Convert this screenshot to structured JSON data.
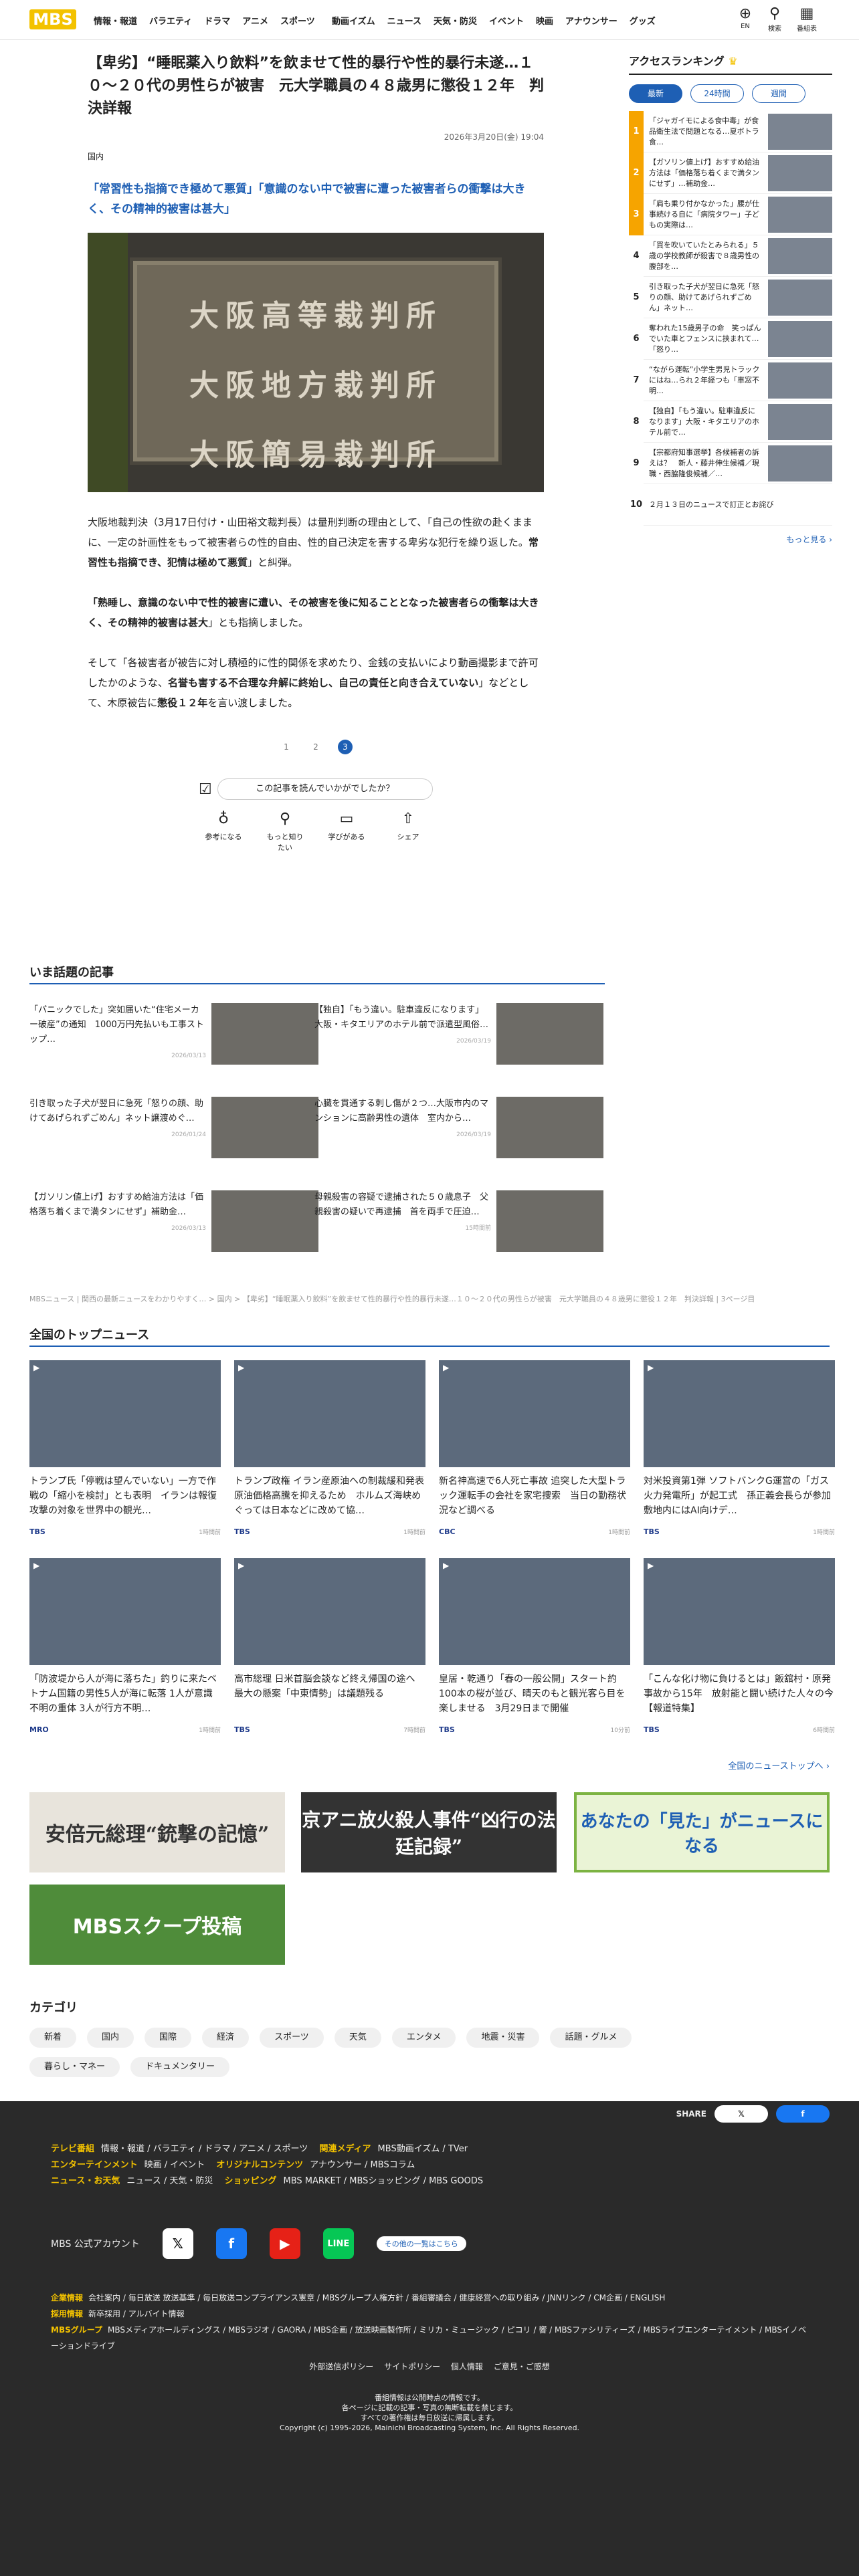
{
  "header": {
    "logo": "MBS",
    "nav1": [
      "情報・報道",
      "バラエティ",
      "ドラマ",
      "アニメ",
      "スポーツ"
    ],
    "nav2": [
      "動画イズム",
      "ニュース",
      "天気・防災",
      "イベント",
      "映画",
      "アナウンサー",
      "グッズ"
    ],
    "icons": [
      {
        "label": "EN",
        "icon": "globe-icon"
      },
      {
        "label": "検索",
        "icon": "search-icon"
      },
      {
        "label": "番組表",
        "icon": "calendar-icon"
      }
    ]
  },
  "article": {
    "title": "【卑劣】“睡眠薬入り飲料”を飲ませて性的暴行や性的暴行未遂…１０～２０代の男性らが被害　元大学職員の４８歳男に懲役１２年　判決詳報",
    "date": "2026年3月20日(金) 19:04",
    "category": "国内",
    "lead": "「常習性も指摘でき極めて悪質」「意識のない中で被害に遭った被害者らの衝撃は大きく、その精神的被害は甚大」",
    "plaque": [
      "大阪高等裁判所",
      "大阪地方裁判所",
      "大阪簡易裁判所"
    ],
    "p1a": "大阪地裁判決（3月17日付け・山田裕文裁判長）は量刑判断の理由として、「自己の性欲の赴くままに、一定の計画性をもって被害者らの性的自由、性的自己決定を害する卑劣な犯行を繰り返した。",
    "p1b": "常習性も指摘でき、犯情は極めて悪質",
    "p1c": "」と糾弾。",
    "p2a": "「熟睡し、意識のない中で性的被害に遭い、その被害を後に知ることとなった被害者らの衝撃は大きく、その精神的被害は甚大",
    "p2b": "」とも指摘しました。",
    "p3a": "そして「各被害者が被告に対し積極的に性的関係を求めたり、金銭の支払いにより動画撮影まで許可したかのような、",
    "p3b": "名誉も害する不合理な弁解に終始し、自己の責任と向き合えていない",
    "p3c": "」などとして、木原被告に",
    "p3d": "懲役１２年",
    "p3e": "を言い渡しました。",
    "pages": [
      "1",
      "2",
      "3"
    ],
    "survey": "この記事を読んでいかがでしたか？",
    "reactions": [
      {
        "label": "参考になる",
        "icon": "bulb-icon"
      },
      {
        "label": "もっと知りたい",
        "icon": "search-icon"
      },
      {
        "label": "学びがある",
        "icon": "book-icon"
      },
      {
        "label": "シェア",
        "icon": "share-icon"
      }
    ]
  },
  "ranking": {
    "title": "アクセスランキング",
    "tabs": [
      "最新",
      "24時間",
      "週間"
    ],
    "items": [
      {
        "no": "1",
        "text": "「ジャガイモによる食中毒」が食品衛生法で問題となる…夏ボトラ食…",
        "color": "#f6a400"
      },
      {
        "no": "2",
        "text": "【ガソリン値上げ】おすすめ給油方法は「価格落ち着くまで満タンにせず」…補助金…",
        "color": "#f6a400"
      },
      {
        "no": "3",
        "text": "「肩も乗り付かなかった」腰が仕事続ける自に「病院タワー」子どもの実際は…",
        "color": "#f6a400"
      },
      {
        "no": "4",
        "text": "「買を吹いていたとみられる」５歳の学校教師が殺害で８歳男性の腹部を…",
        "color": "#fff"
      },
      {
        "no": "5",
        "text": "引き取った子犬が翌日に急死「怒りの顔、助けてあげられずごめん」ネット…",
        "color": "#fff"
      },
      {
        "no": "6",
        "text": "奪われた15歳男子の命　笑っぱんでいた車とフェンスに挟まれて…「怒り…",
        "color": "#fff"
      },
      {
        "no": "7",
        "text": "“ながら運転”小学生男児トラックにはね…られ２年経つも「車窓不明…",
        "color": "#fff"
      },
      {
        "no": "8",
        "text": "【独自】「もう違い。駐車違反になります」大阪・キタエリアのホテル前で…",
        "color": "#fff"
      },
      {
        "no": "9",
        "text": "【宗都府知事選挙】各候補者の訴えは？　新人・藤井伸生候補／現職・西脇隆俊候補／…",
        "color": "#fff"
      },
      {
        "no": "10",
        "text": "２月１３日のニュースで訂正とお詫び",
        "color": "#fff"
      }
    ],
    "more": "もっと見る ›"
  },
  "topics": {
    "title": "いま話題の記事",
    "items": [
      {
        "t": "「パニックでした」突如届いた“住宅メーカー破産”の通知　1000万円先払いも工事ストップ…",
        "d": "2026/03/13"
      },
      {
        "t": "【独自】「もう違い。駐車違反になります」大阪・キタエリアのホテル前で派遣型風俗…",
        "d": "2026/03/19"
      },
      {
        "t": "引き取った子犬が翌日に急死「怒りの顔、助けてあげられずごめん」ネット譲渡めぐ…",
        "d": "2026/01/24"
      },
      {
        "t": "心臓を貫通する刺し傷が２つ…大阪市内のマンションに高齢男性の遺体　室内から…",
        "d": "2026/03/19"
      },
      {
        "t": "【ガソリン値上げ】おすすめ給油方法は「価格落ち着くまで満タンにせず」補助金…",
        "d": "2026/03/13"
      },
      {
        "t": "母親殺害の容疑で逮捕された５０歳息子　父親殺害の疑いで再逮捕　首を両手で圧迫…",
        "d": "15時間前"
      }
    ]
  },
  "breadcrumb": "MBSニュース | 関西の最新ニュースをわかりやすく… > 国内 > 【卑劣】“睡眠薬入り飲料”を飲ませて性的暴行や性的暴行未遂…１０～２０代の男性らが被害　元大学職員の４８歳男に懲役１２年　判決詳報 | 3ページ目",
  "national": {
    "title": "全国のトップニュース",
    "items": [
      {
        "t": "トランプ氏「停戦は望んでいない」一方で作戦の「縮小を検討」とも表明　イランは報復攻撃の対象を世界中の観光…",
        "s": "TBS",
        "d": "1時間前"
      },
      {
        "t": "トランプ政権 イラン産原油への制裁緩和発表 原油価格高騰を抑えるため　ホルムズ海峡めぐっては日本などに改めて協…",
        "s": "TBS",
        "d": "1時間前"
      },
      {
        "t": "新名神高速で6人死亡事故 追突した大型トラック運転手の会社を家宅捜索　当日の勤務状況など調べる",
        "s": "CBC",
        "d": "1時間前"
      },
      {
        "t": "対米投資第1弾 ソフトバンクG運営の「ガス火力発電所」が起工式　孫正義会長らが参加　敷地内にはAI向けデ…",
        "s": "TBS",
        "d": "1時間前"
      },
      {
        "t": "「防波堤から人が海に落ちた」釣りに来たベトナム国籍の男性5人が海に転落 1人が意識不明の重体 3人が行方不明…",
        "s": "MRO",
        "d": "1時間前"
      },
      {
        "t": "高市総理 日米首脳会談など終え帰国の途へ　最大の懸案「中東情勢」は議題残る",
        "s": "TBS",
        "d": "7時間前"
      },
      {
        "t": "皇居・乾通り「春の一般公開」スタート約100本の桜が並び、晴天のもと観光客ら目を楽しませる　3月29日まで開催",
        "s": "TBS",
        "d": "10分前"
      },
      {
        "t": "「こんな化け物に負けるとは」飯舘村・原発事故から15年　放射能と闘い続けた人々の今【報道特集】",
        "s": "TBS",
        "d": "6時間前"
      }
    ],
    "more": "全国のニューストップへ ›"
  },
  "banners": [
    "安倍元総理“銃撃の記憶”",
    "京アニ放火殺人事件“凶行の法廷記録”",
    "あなたの「見た」がニュースになる",
    "MBSスクープ投稿"
  ],
  "categories": {
    "title": "カテゴリ",
    "items": [
      "新着",
      "国内",
      "国際",
      "経済",
      "スポーツ",
      "天気",
      "エンタメ",
      "地震・災害",
      "話題・グルメ",
      "暮らし・マネー",
      "ドキュメンタリー"
    ]
  },
  "footer": {
    "share": "SHARE",
    "l1": [
      "テレビ番組",
      "情報・報道 / バラエティ / ドラマ / アニメ / スポーツ",
      "関連メディア",
      "MBS動画イズム / TVer"
    ],
    "l2": [
      "エンターテインメント",
      "映画 / イベント",
      "オリジナルコンテンツ",
      "アナウンサー / MBSコラム"
    ],
    "l3": [
      "ニュース・お天気",
      "ニュース / 天気・防災",
      "ショッピング",
      "MBS MARKET / MBSショッピング / MBS GOODS"
    ],
    "account": "MBS 公式アカウント",
    "list": "その他の一覧はこちら",
    "corp": [
      "企業情報",
      "会社案内 / 毎日放送 放送基準 / 毎日放送コンプライアンス憲章 / MBSグループ人権方針 / 番組審議会 / 健康経営への取り組み / JNNリンク / CM企画 / ENGLISH"
    ],
    "recruit": [
      "採用情報",
      "新卒採用 / アルバイト情報"
    ],
    "group": [
      "MBSグループ",
      "MBSメディアホールディングス / MBSラジオ / GAORA / MBS企画 / 放送映画製作所 / ミリカ・ミュージック / ピコリ / 響 / MBSファシリティーズ / MBSライブエンターテイメント / MBSイノベーションドライブ"
    ],
    "policy": "外部送信ポリシー　 サイトポリシー　 個人情報　 ご意見・ご感想",
    "cr1": "番組情報は公開時点の情報です。",
    "cr2": "各ページに記載の記事・写真の無断転載を禁じます。",
    "cr3": "すべての著作権は毎日放送に帰属します。",
    "cr4": "Copyright (c) 1995-2026, Mainichi Broadcasting System, Inc. All Rights Reserved."
  }
}
